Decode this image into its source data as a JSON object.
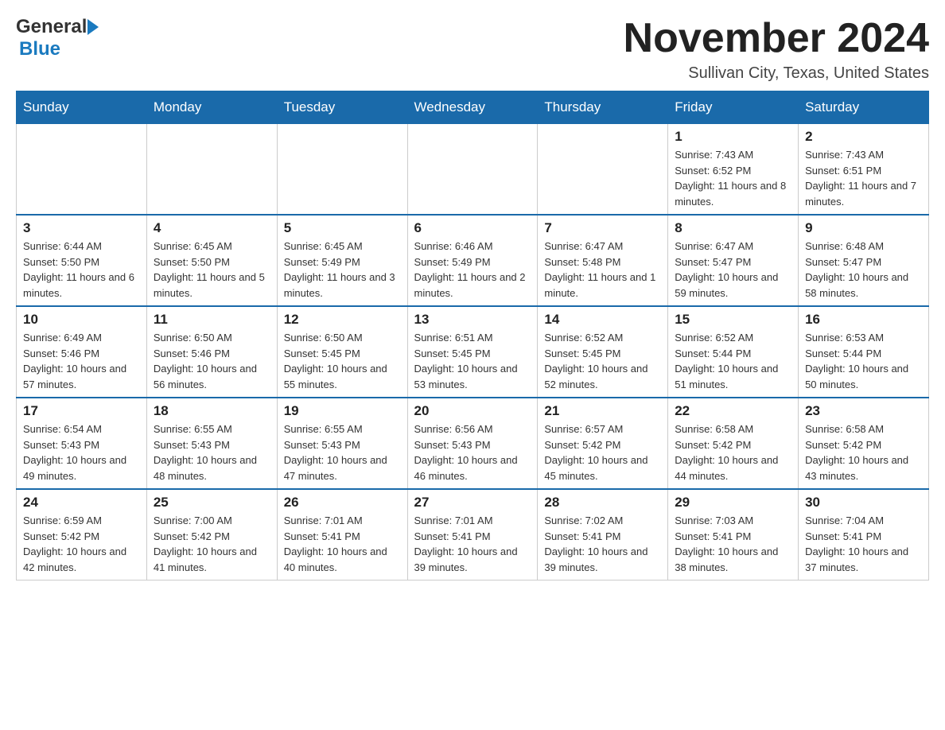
{
  "header": {
    "month_title": "November 2024",
    "location": "Sullivan City, Texas, United States",
    "logo_general": "General",
    "logo_blue": "Blue"
  },
  "weekdays": [
    "Sunday",
    "Monday",
    "Tuesday",
    "Wednesday",
    "Thursday",
    "Friday",
    "Saturday"
  ],
  "weeks": [
    [
      {
        "day": "",
        "sunrise": "",
        "sunset": "",
        "daylight": ""
      },
      {
        "day": "",
        "sunrise": "",
        "sunset": "",
        "daylight": ""
      },
      {
        "day": "",
        "sunrise": "",
        "sunset": "",
        "daylight": ""
      },
      {
        "day": "",
        "sunrise": "",
        "sunset": "",
        "daylight": ""
      },
      {
        "day": "",
        "sunrise": "",
        "sunset": "",
        "daylight": ""
      },
      {
        "day": "1",
        "sunrise": "Sunrise: 7:43 AM",
        "sunset": "Sunset: 6:52 PM",
        "daylight": "Daylight: 11 hours and 8 minutes."
      },
      {
        "day": "2",
        "sunrise": "Sunrise: 7:43 AM",
        "sunset": "Sunset: 6:51 PM",
        "daylight": "Daylight: 11 hours and 7 minutes."
      }
    ],
    [
      {
        "day": "3",
        "sunrise": "Sunrise: 6:44 AM",
        "sunset": "Sunset: 5:50 PM",
        "daylight": "Daylight: 11 hours and 6 minutes."
      },
      {
        "day": "4",
        "sunrise": "Sunrise: 6:45 AM",
        "sunset": "Sunset: 5:50 PM",
        "daylight": "Daylight: 11 hours and 5 minutes."
      },
      {
        "day": "5",
        "sunrise": "Sunrise: 6:45 AM",
        "sunset": "Sunset: 5:49 PM",
        "daylight": "Daylight: 11 hours and 3 minutes."
      },
      {
        "day": "6",
        "sunrise": "Sunrise: 6:46 AM",
        "sunset": "Sunset: 5:49 PM",
        "daylight": "Daylight: 11 hours and 2 minutes."
      },
      {
        "day": "7",
        "sunrise": "Sunrise: 6:47 AM",
        "sunset": "Sunset: 5:48 PM",
        "daylight": "Daylight: 11 hours and 1 minute."
      },
      {
        "day": "8",
        "sunrise": "Sunrise: 6:47 AM",
        "sunset": "Sunset: 5:47 PM",
        "daylight": "Daylight: 10 hours and 59 minutes."
      },
      {
        "day": "9",
        "sunrise": "Sunrise: 6:48 AM",
        "sunset": "Sunset: 5:47 PM",
        "daylight": "Daylight: 10 hours and 58 minutes."
      }
    ],
    [
      {
        "day": "10",
        "sunrise": "Sunrise: 6:49 AM",
        "sunset": "Sunset: 5:46 PM",
        "daylight": "Daylight: 10 hours and 57 minutes."
      },
      {
        "day": "11",
        "sunrise": "Sunrise: 6:50 AM",
        "sunset": "Sunset: 5:46 PM",
        "daylight": "Daylight: 10 hours and 56 minutes."
      },
      {
        "day": "12",
        "sunrise": "Sunrise: 6:50 AM",
        "sunset": "Sunset: 5:45 PM",
        "daylight": "Daylight: 10 hours and 55 minutes."
      },
      {
        "day": "13",
        "sunrise": "Sunrise: 6:51 AM",
        "sunset": "Sunset: 5:45 PM",
        "daylight": "Daylight: 10 hours and 53 minutes."
      },
      {
        "day": "14",
        "sunrise": "Sunrise: 6:52 AM",
        "sunset": "Sunset: 5:45 PM",
        "daylight": "Daylight: 10 hours and 52 minutes."
      },
      {
        "day": "15",
        "sunrise": "Sunrise: 6:52 AM",
        "sunset": "Sunset: 5:44 PM",
        "daylight": "Daylight: 10 hours and 51 minutes."
      },
      {
        "day": "16",
        "sunrise": "Sunrise: 6:53 AM",
        "sunset": "Sunset: 5:44 PM",
        "daylight": "Daylight: 10 hours and 50 minutes."
      }
    ],
    [
      {
        "day": "17",
        "sunrise": "Sunrise: 6:54 AM",
        "sunset": "Sunset: 5:43 PM",
        "daylight": "Daylight: 10 hours and 49 minutes."
      },
      {
        "day": "18",
        "sunrise": "Sunrise: 6:55 AM",
        "sunset": "Sunset: 5:43 PM",
        "daylight": "Daylight: 10 hours and 48 minutes."
      },
      {
        "day": "19",
        "sunrise": "Sunrise: 6:55 AM",
        "sunset": "Sunset: 5:43 PM",
        "daylight": "Daylight: 10 hours and 47 minutes."
      },
      {
        "day": "20",
        "sunrise": "Sunrise: 6:56 AM",
        "sunset": "Sunset: 5:43 PM",
        "daylight": "Daylight: 10 hours and 46 minutes."
      },
      {
        "day": "21",
        "sunrise": "Sunrise: 6:57 AM",
        "sunset": "Sunset: 5:42 PM",
        "daylight": "Daylight: 10 hours and 45 minutes."
      },
      {
        "day": "22",
        "sunrise": "Sunrise: 6:58 AM",
        "sunset": "Sunset: 5:42 PM",
        "daylight": "Daylight: 10 hours and 44 minutes."
      },
      {
        "day": "23",
        "sunrise": "Sunrise: 6:58 AM",
        "sunset": "Sunset: 5:42 PM",
        "daylight": "Daylight: 10 hours and 43 minutes."
      }
    ],
    [
      {
        "day": "24",
        "sunrise": "Sunrise: 6:59 AM",
        "sunset": "Sunset: 5:42 PM",
        "daylight": "Daylight: 10 hours and 42 minutes."
      },
      {
        "day": "25",
        "sunrise": "Sunrise: 7:00 AM",
        "sunset": "Sunset: 5:42 PM",
        "daylight": "Daylight: 10 hours and 41 minutes."
      },
      {
        "day": "26",
        "sunrise": "Sunrise: 7:01 AM",
        "sunset": "Sunset: 5:41 PM",
        "daylight": "Daylight: 10 hours and 40 minutes."
      },
      {
        "day": "27",
        "sunrise": "Sunrise: 7:01 AM",
        "sunset": "Sunset: 5:41 PM",
        "daylight": "Daylight: 10 hours and 39 minutes."
      },
      {
        "day": "28",
        "sunrise": "Sunrise: 7:02 AM",
        "sunset": "Sunset: 5:41 PM",
        "daylight": "Daylight: 10 hours and 39 minutes."
      },
      {
        "day": "29",
        "sunrise": "Sunrise: 7:03 AM",
        "sunset": "Sunset: 5:41 PM",
        "daylight": "Daylight: 10 hours and 38 minutes."
      },
      {
        "day": "30",
        "sunrise": "Sunrise: 7:04 AM",
        "sunset": "Sunset: 5:41 PM",
        "daylight": "Daylight: 10 hours and 37 minutes."
      }
    ]
  ]
}
